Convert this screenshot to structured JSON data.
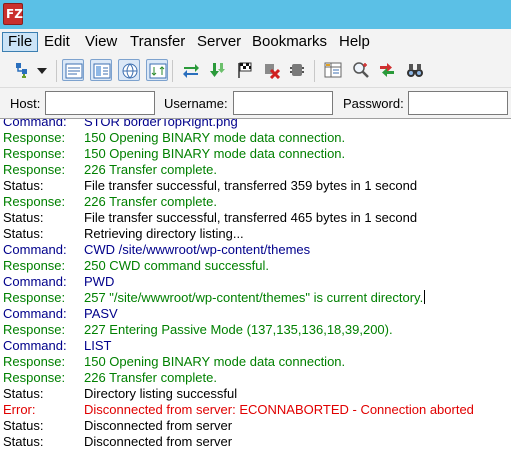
{
  "app": {
    "icon_letter": "FZ",
    "icon_name": "filezilla-icon"
  },
  "menu": [
    "File",
    "Edit",
    "View",
    "Transfer",
    "Server",
    "Bookmarks",
    "Help"
  ],
  "toolbar": {
    "buttons": [
      "site-manager-icon",
      "dropdown-arrow-icon",
      "toggle-message-log-icon",
      "toggle-local-tree-icon",
      "toggle-remote-tree-icon",
      "toggle-transfer-queue-icon",
      "refresh-icon",
      "process-queue-icon",
      "cancel-operation-icon",
      "disconnect-icon",
      "reconnect-icon",
      "directory-listing-filters-icon",
      "compare-directories-icon",
      "sync-browsing-icon",
      "search-remote-files-icon"
    ]
  },
  "quickconnect": {
    "host_label": "Host:",
    "host_value": "",
    "username_label": "Username:",
    "username_value": "",
    "password_label": "Password:",
    "password_value": ""
  },
  "log": [
    {
      "type": "Command:",
      "kind": "command",
      "message": "STOR borderTopRight.png"
    },
    {
      "type": "Response:",
      "kind": "response",
      "message": "150 Opening BINARY mode data connection."
    },
    {
      "type": "Response:",
      "kind": "response",
      "message": "150 Opening BINARY mode data connection."
    },
    {
      "type": "Response:",
      "kind": "response",
      "message": "226 Transfer complete."
    },
    {
      "type": "Status:",
      "kind": "status",
      "message": "File transfer successful, transferred 359 bytes in 1 second"
    },
    {
      "type": "Response:",
      "kind": "response",
      "message": "226 Transfer complete."
    },
    {
      "type": "Status:",
      "kind": "status",
      "message": "File transfer successful, transferred 465 bytes in 1 second"
    },
    {
      "type": "Status:",
      "kind": "status",
      "message": "Retrieving directory listing..."
    },
    {
      "type": "Command:",
      "kind": "command",
      "message": "CWD /site/wwwroot/wp-content/themes"
    },
    {
      "type": "Response:",
      "kind": "response",
      "message": "250 CWD command successful."
    },
    {
      "type": "Command:",
      "kind": "command",
      "message": "PWD"
    },
    {
      "type": "Response:",
      "kind": "response",
      "message": "257 \"/site/wwwroot/wp-content/themes\" is current directory."
    },
    {
      "type": "Command:",
      "kind": "command",
      "message": "PASV"
    },
    {
      "type": "Response:",
      "kind": "response",
      "message": "227 Entering Passive Mode (137,135,136,18,39,200)."
    },
    {
      "type": "Command:",
      "kind": "command",
      "message": "LIST"
    },
    {
      "type": "Response:",
      "kind": "response",
      "message": "150 Opening BINARY mode data connection."
    },
    {
      "type": "Response:",
      "kind": "response",
      "message": "226 Transfer complete."
    },
    {
      "type": "Status:",
      "kind": "status",
      "message": "Directory listing successful"
    },
    {
      "type": "Error:",
      "kind": "error",
      "message": "Disconnected from server: ECONNABORTED - Connection aborted"
    },
    {
      "type": "Status:",
      "kind": "status",
      "message": "Disconnected from server"
    },
    {
      "type": "Status:",
      "kind": "status",
      "message": "Disconnected from server"
    }
  ],
  "colors": {
    "titlebar": "#5bc0e6",
    "command": "#00008b",
    "response": "#008000",
    "status": "#000000",
    "error": "#e00000"
  }
}
